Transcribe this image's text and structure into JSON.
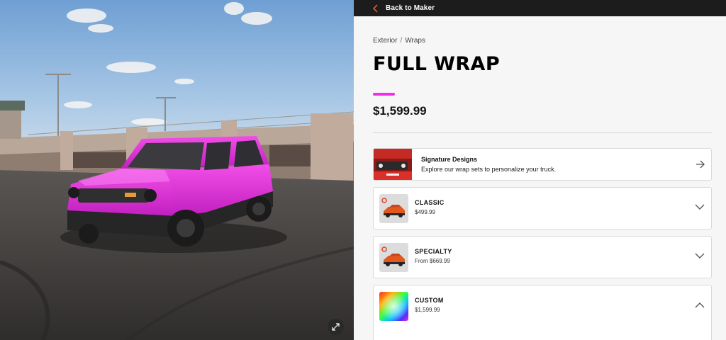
{
  "viewer": {
    "expand_icon": "expand-icon"
  },
  "topbar": {
    "back_label": "Back to Maker",
    "back_icon": "chevron-left-icon",
    "back_icon_color": "#e8562a"
  },
  "breadcrumb": {
    "items": [
      "Exterior",
      "Wraps"
    ],
    "separator": "/"
  },
  "product": {
    "title": "FULL WRAP",
    "price": "$1,599.99",
    "accent_color": "#f22ce8"
  },
  "signature": {
    "title": "Signature Designs",
    "description": "Explore our wrap sets to personalize your truck.",
    "icon": "arrow-right-icon"
  },
  "options": [
    {
      "name": "CLASSIC",
      "price": "$499.99",
      "expanded": false
    },
    {
      "name": "SPECIALTY",
      "price": "From $669.99",
      "expanded": false
    },
    {
      "name": "CUSTOM",
      "price": "$1,599.99",
      "expanded": true
    }
  ]
}
